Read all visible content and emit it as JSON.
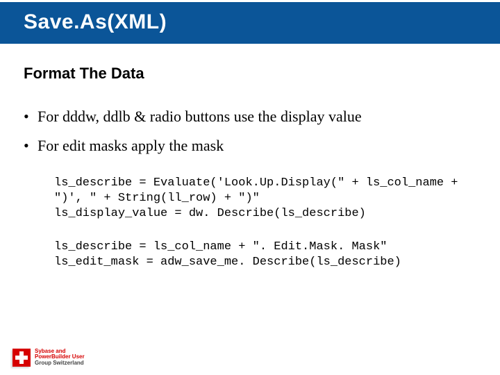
{
  "title": "Save.As(XML)",
  "section_heading": "Format The Data",
  "bullets": [
    "For dddw, ddlb & radio buttons use the display value",
    "For edit masks apply the mask"
  ],
  "code": {
    "block1": "ls_describe = Evaluate('Look.Up.Display(\" + ls_col_name + \")', \" + String(ll_row) + \")\"\nls_display_value = dw. Describe(ls_describe)",
    "block2": "ls_describe = ls_col_name + \". Edit.Mask. Mask\"\nls_edit_mask = adw_save_me. Describe(ls_describe)"
  },
  "footer": {
    "line1": "Sybase and",
    "line2": "PowerBuilder User",
    "line3": "Group Switzerland"
  }
}
